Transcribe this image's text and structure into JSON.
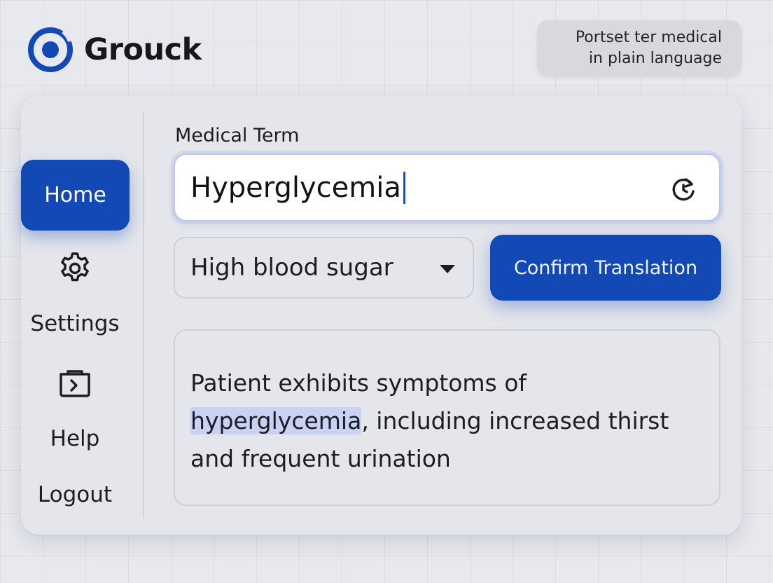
{
  "app": {
    "name": "Grouck",
    "tagline_line1": "Portset ter medical",
    "tagline_line2": "in plain language"
  },
  "sidebar": {
    "home_label": "Home",
    "settings_label": "Settings",
    "help_label": "Help",
    "logout_label": "Logout"
  },
  "form": {
    "term_label": "Medical Term",
    "term_value": "Hyperglycemia",
    "translation_selected": "High blood sugar",
    "confirm_label": "Confirm Translation"
  },
  "output": {
    "text_before": "Patient exhibits symptoms of ",
    "highlighted_term": "hyperglycemia",
    "text_after": ", including increased thirst and frequent urination"
  },
  "colors": {
    "accent": "#1349b4",
    "highlight": "#c9d2f3",
    "background": "#e7e9ee"
  },
  "icons": {
    "logo": "ring-logo-icon",
    "settings": "gear-icon",
    "help": "folder-arrow-icon",
    "refresh": "refresh-icon",
    "dropdown": "triangle-down-icon"
  }
}
